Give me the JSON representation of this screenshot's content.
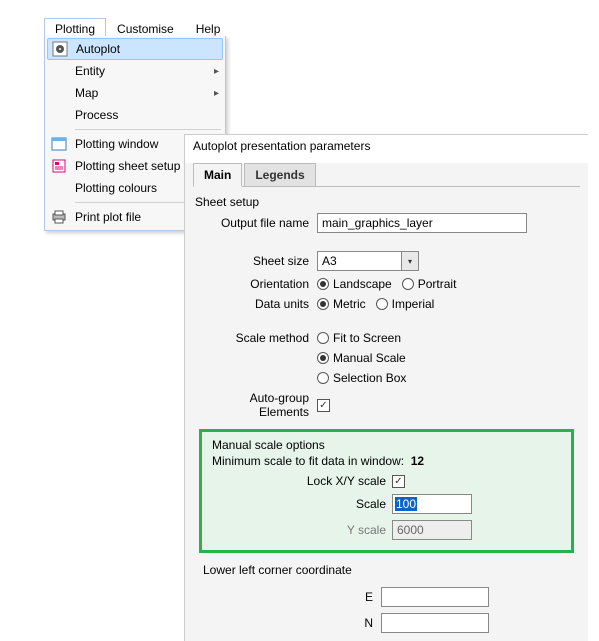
{
  "menubar": {
    "plotting": "Plotting",
    "customise": "Customise",
    "help": "Help"
  },
  "menu": {
    "autoplot": "Autoplot",
    "entity": "Entity",
    "map": "Map",
    "process": "Process",
    "plot_window": "Plotting window",
    "plot_sheet_setup": "Plotting sheet setup",
    "plot_colours": "Plotting colours",
    "print_plot": "Print plot file"
  },
  "dialog": {
    "title": "Autoplot presentation parameters",
    "tabs": {
      "main": "Main",
      "legends": "Legends"
    },
    "sheet_setup": "Sheet setup",
    "output_file_label": "Output file name",
    "output_file_value": "main_graphics_layer",
    "sheet_size_label": "Sheet size",
    "sheet_size_value": "A3",
    "orientation_label": "Orientation",
    "orientation_landscape": "Landscape",
    "orientation_portrait": "Portrait",
    "data_units_label": "Data units",
    "units_metric": "Metric",
    "units_imperial": "Imperial",
    "scale_method_label": "Scale method",
    "fit_to_screen": "Fit to Screen",
    "manual_scale": "Manual Scale",
    "selection_box": "Selection Box",
    "auto_group_label": "Auto-group Elements",
    "manual_scale_options": "Manual scale options",
    "min_scale_label": "Minimum scale to fit data in window:",
    "min_scale_value": "12",
    "lock_xy_label": "Lock X/Y scale",
    "scale_label": "Scale",
    "scale_value": "100",
    "yscale_label": "Y scale",
    "yscale_value": "6000",
    "lower_left_label": "Lower left corner coordinate",
    "e_label": "E",
    "n_label": "N",
    "e_value": "",
    "n_value": ""
  }
}
